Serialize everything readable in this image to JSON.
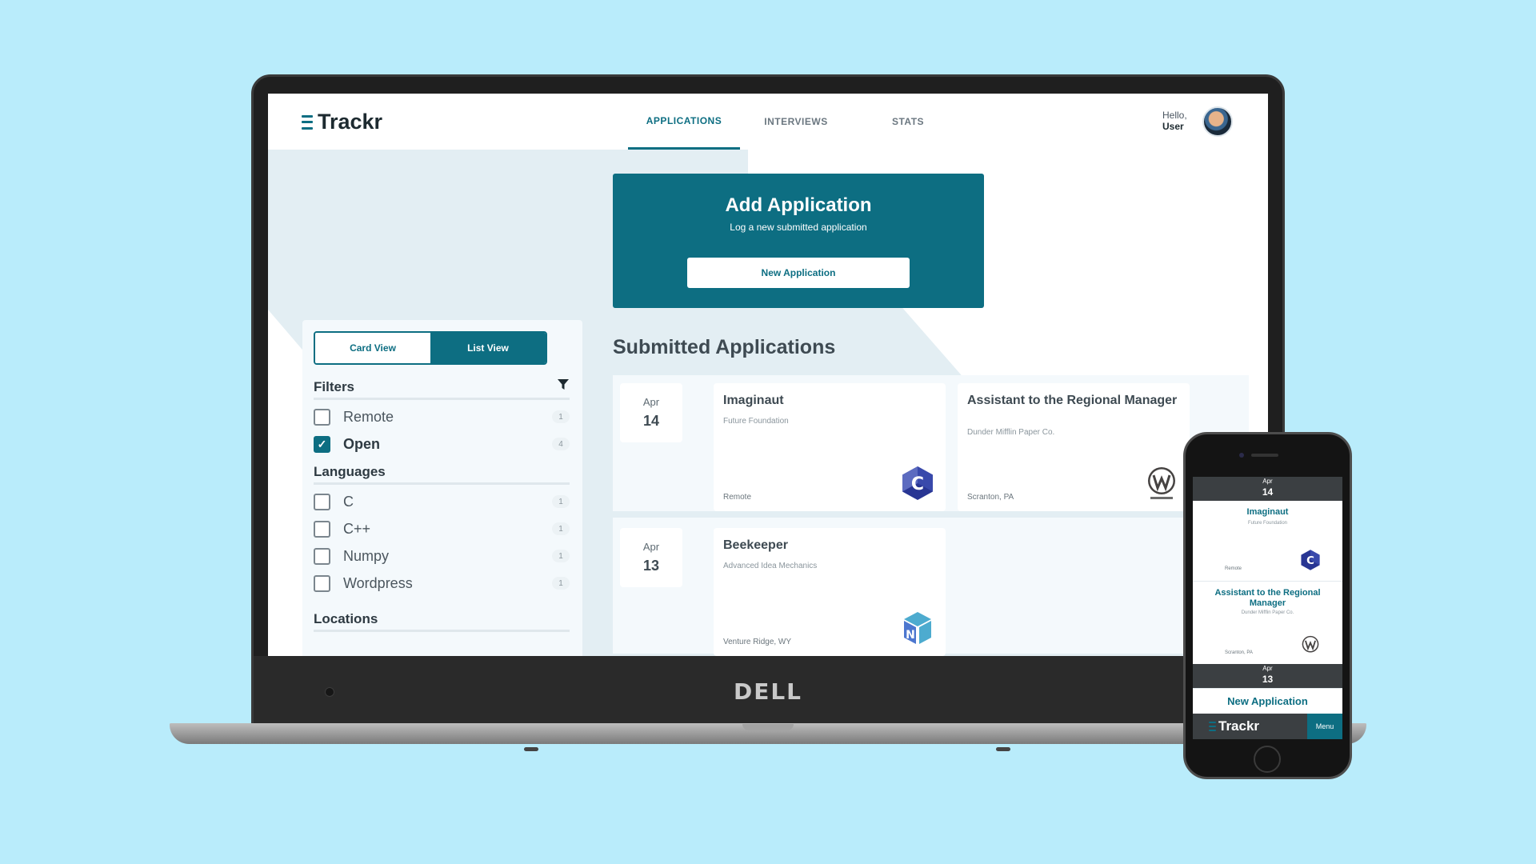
{
  "app": {
    "logo_text": "Trackr",
    "nav": {
      "tabs": [
        {
          "label": "APPLICATIONS",
          "active": true
        },
        {
          "label": "INTERVIEWS",
          "active": false
        },
        {
          "label": "STATS",
          "active": false
        }
      ]
    },
    "greeting": "Hello,",
    "user_name": "User"
  },
  "add_application": {
    "title": "Add Application",
    "subtitle": "Log a new submitted application",
    "button_label": "New Application"
  },
  "view_toggle": {
    "card_label": "Card View",
    "list_label": "List View",
    "selected": "List View"
  },
  "filters": {
    "title": "Filters",
    "items": [
      {
        "label": "Remote",
        "count": "1",
        "checked": false
      },
      {
        "label": "Open",
        "count": "4",
        "checked": true
      }
    ]
  },
  "languages": {
    "title": "Languages",
    "items": [
      {
        "label": "C",
        "count": "1",
        "checked": false
      },
      {
        "label": "C++",
        "count": "1",
        "checked": false
      },
      {
        "label": "Numpy",
        "count": "1",
        "checked": false
      },
      {
        "label": "Wordpress",
        "count": "1",
        "checked": false
      }
    ]
  },
  "locations": {
    "title": "Locations"
  },
  "submitted": {
    "title": "Submitted Applications",
    "groups": [
      {
        "month": "Apr",
        "day": "14",
        "applications": [
          {
            "title": "Imaginaut",
            "company": "Future Foundation",
            "location": "Remote",
            "logo_icon": "c-language-icon"
          },
          {
            "title": "Assistant to the Regional Manager",
            "company": "Dunder Mifflin Paper Co.",
            "location": "Scranton, PA",
            "logo_icon": "wordpress-icon"
          }
        ]
      },
      {
        "month": "Apr",
        "day": "13",
        "applications": [
          {
            "title": "Beekeeper",
            "company": "Advanced Idea Mechanics",
            "location": "Venture Ridge, WY",
            "logo_icon": "numpy-icon"
          }
        ]
      }
    ]
  },
  "device": {
    "laptop_brand": "DELL"
  },
  "mobile": {
    "new_application_label": "New Application",
    "logo_text": "Trackr",
    "menu_label": "Menu",
    "partial_day": "13"
  },
  "colors": {
    "accent": "#0d6e82",
    "background": "#b9ecfb",
    "panel": "#f4f9fc"
  }
}
